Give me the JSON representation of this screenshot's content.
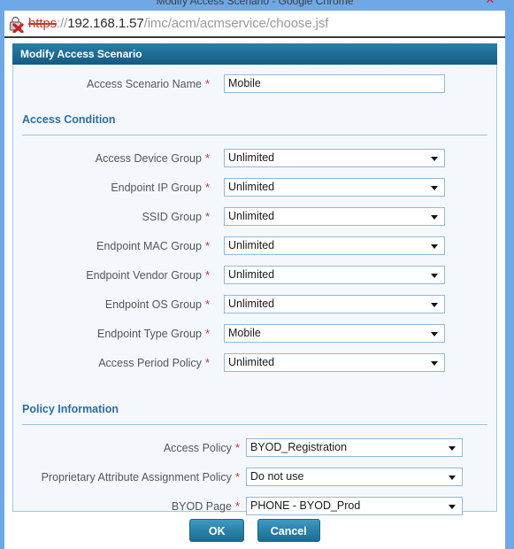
{
  "browser": {
    "window_title": "Modify Access Scenario - Google Chrome",
    "close_label": "✕",
    "security_icon": "broken-https-lock-icon",
    "url_scheme": "https",
    "url_separator": "://",
    "url_host": "192.168.1.57",
    "url_path": "/imc/acm/acmservice/choose.jsf"
  },
  "panel": {
    "title": "Modify Access Scenario"
  },
  "name_field": {
    "label": "Access Scenario Name",
    "required": "*",
    "value": "Mobile"
  },
  "sections": [
    {
      "title": "Access Condition"
    },
    {
      "title": "Policy Information"
    }
  ],
  "access_condition": {
    "fields": [
      {
        "label": "Access Device Group",
        "required": "*",
        "value": "Unlimited"
      },
      {
        "label": "Endpoint IP Group",
        "required": "*",
        "value": "Unlimited"
      },
      {
        "label": "SSID Group",
        "required": "*",
        "value": "Unlimited"
      },
      {
        "label": "Endpoint MAC Group",
        "required": "*",
        "value": "Unlimited"
      },
      {
        "label": "Endpoint Vendor Group",
        "required": "*",
        "value": "Unlimited"
      },
      {
        "label": "Endpoint OS Group",
        "required": "*",
        "value": "Unlimited"
      },
      {
        "label": "Endpoint Type Group",
        "required": "*",
        "value": "Mobile"
      },
      {
        "label": "Access Period Policy",
        "required": "*",
        "value": "Unlimited"
      }
    ]
  },
  "policy_information": {
    "fields": [
      {
        "label": "Access Policy",
        "required": "*",
        "value": "BYOD_Registration"
      },
      {
        "label": "Proprietary Attribute Assignment Policy",
        "required": "*",
        "value": "Do not use"
      },
      {
        "label": "BYOD Page",
        "required": "*",
        "value": "PHONE - BYOD_Prod"
      }
    ]
  },
  "buttons": {
    "ok": "OK",
    "cancel": "Cancel"
  },
  "colors": {
    "chrome_frame": "#6fa8e6",
    "panel_header": "#1f6e98",
    "panel_bg": "#f4f8fd",
    "section_title": "#2e6da4",
    "required_mark": "#cc3333",
    "button": "#2e86ad"
  }
}
